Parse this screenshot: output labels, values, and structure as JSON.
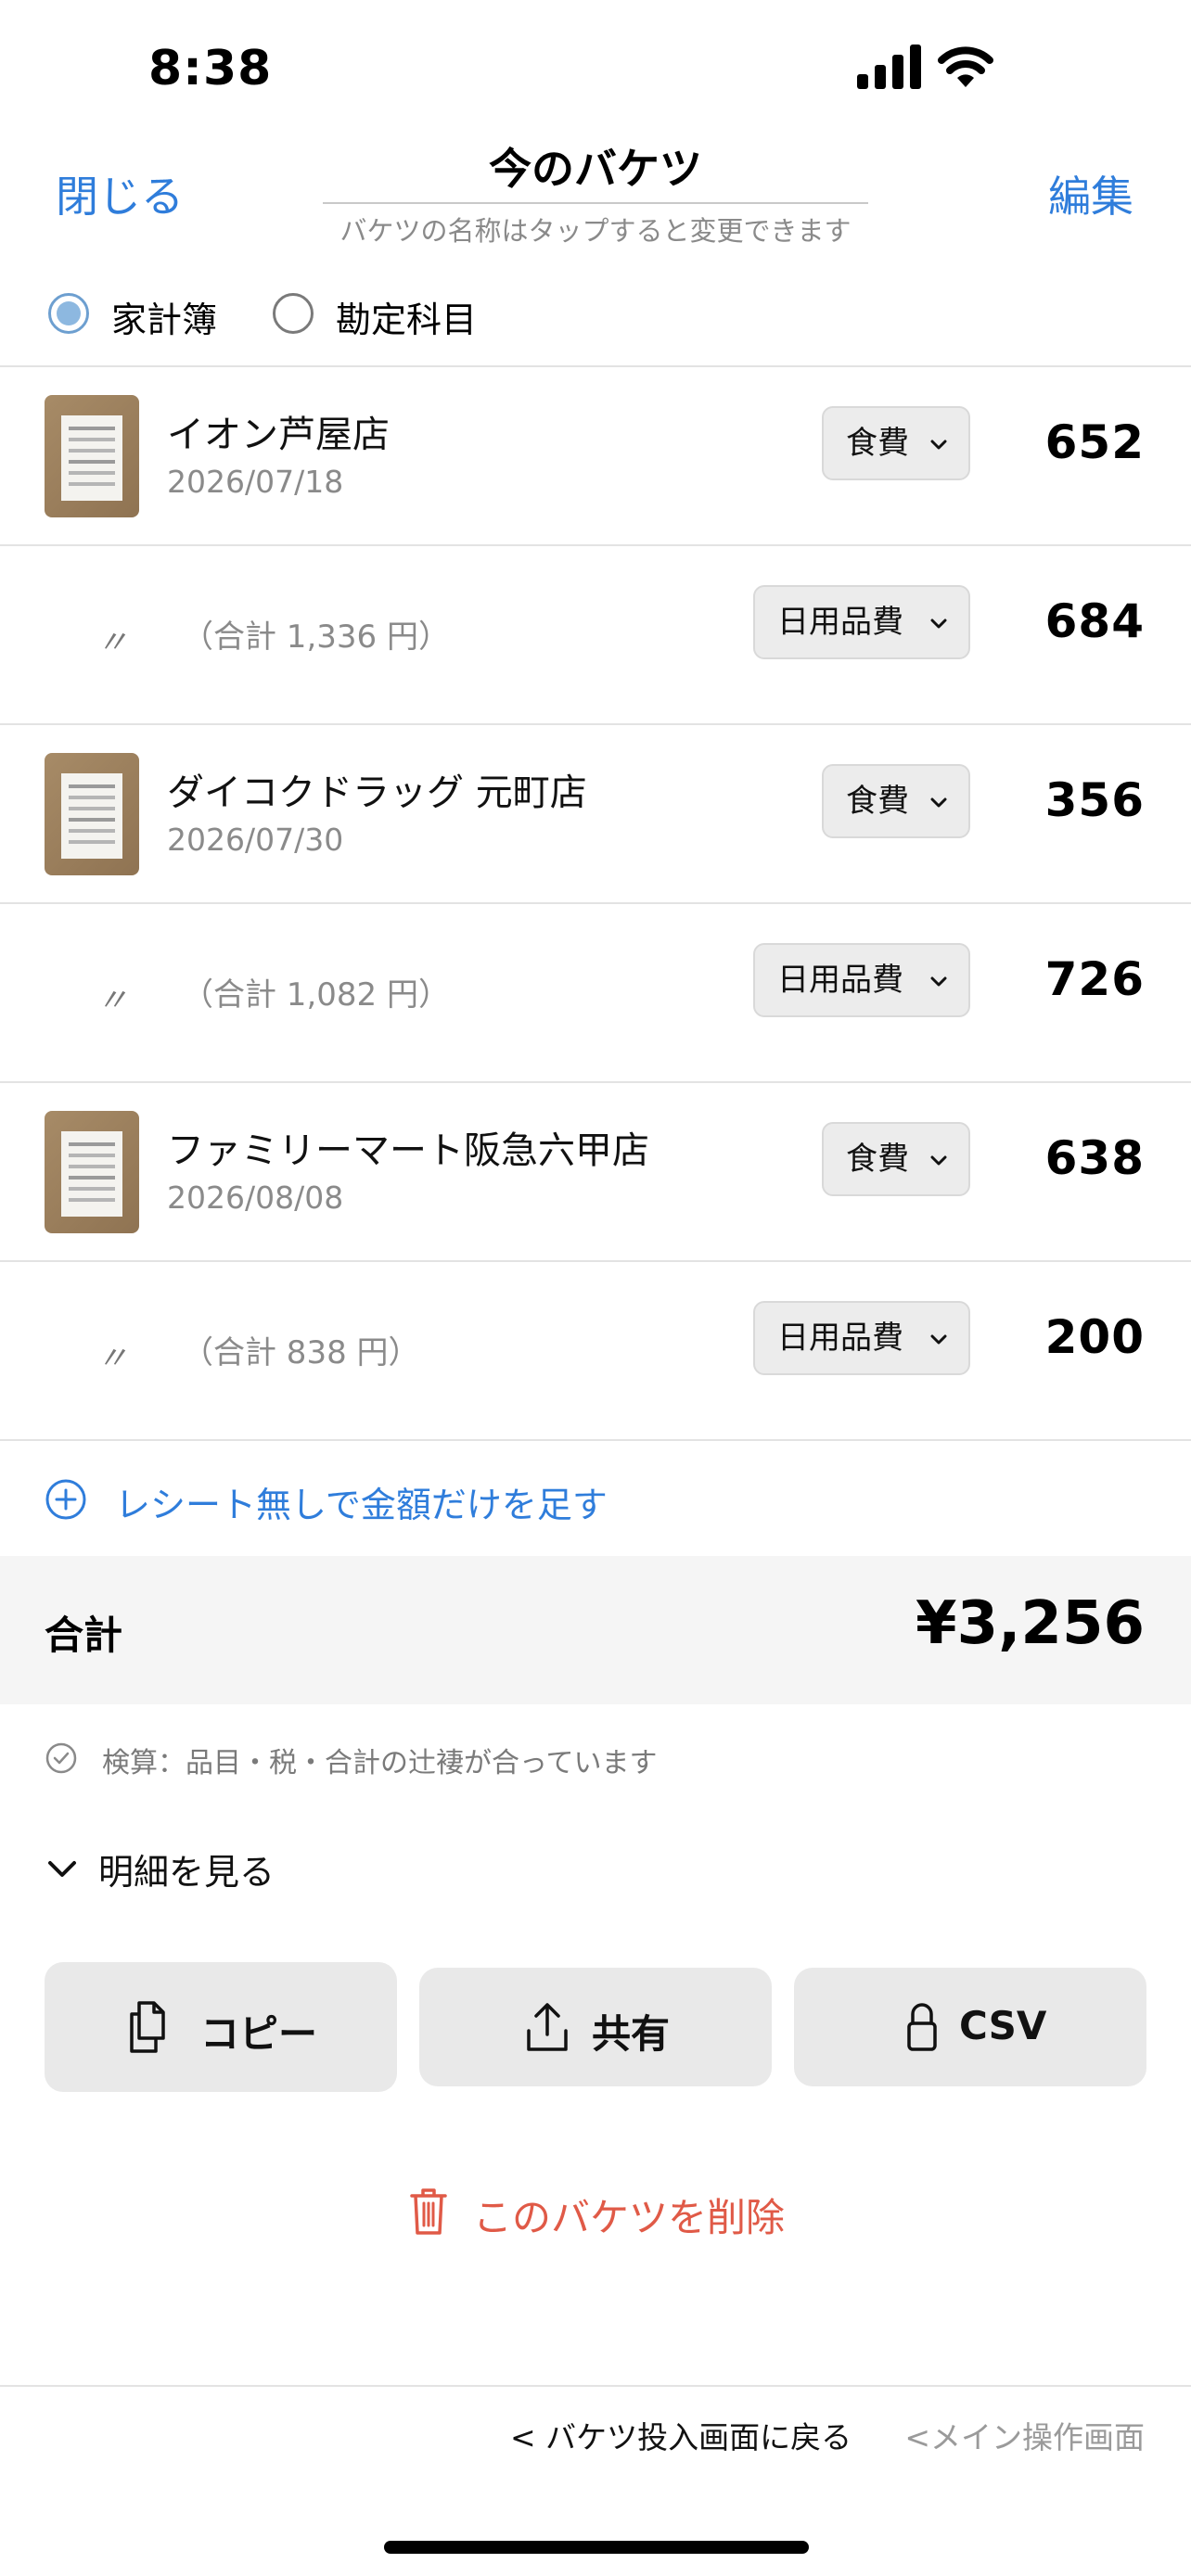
{
  "status": {
    "time": "8:38"
  },
  "nav": {
    "close": "閉じる",
    "title": "今のバケツ",
    "hint": "バケツの名称はタップすると変更できます",
    "edit": "編集"
  },
  "mode": {
    "options": [
      {
        "label": "家計簿",
        "selected": true
      },
      {
        "label": "勘定科目",
        "selected": false
      }
    ]
  },
  "rows": [
    {
      "kind": "receipt",
      "store": "イオン芦屋店",
      "date": "2026/07/18",
      "category": "食費",
      "amount": "652"
    },
    {
      "kind": "split",
      "ditto": "〃",
      "subtotal": "（合計 1,336 円）",
      "category": "日用品費",
      "amount": "684"
    },
    {
      "kind": "receipt",
      "store": "ダイコクドラッグ 元町店",
      "date": "2026/07/30",
      "category": "食費",
      "amount": "356"
    },
    {
      "kind": "split",
      "ditto": "〃",
      "subtotal": "（合計 1,082 円）",
      "category": "日用品費",
      "amount": "726"
    },
    {
      "kind": "receipt",
      "store": "ファミリーマート阪急六甲店",
      "date": "2026/08/08",
      "category": "食費",
      "amount": "638"
    },
    {
      "kind": "split",
      "ditto": "〃",
      "subtotal": "（合計 838 円）",
      "category": "日用品費",
      "amount": "200"
    }
  ],
  "add_amount": {
    "label": "レシート無しで金額だけを足す"
  },
  "total": {
    "label": "合計",
    "value": "¥3,256"
  },
  "verification": {
    "text": "検算：品目・税・合計の辻褄が合っています"
  },
  "details": {
    "label": "明細を見る"
  },
  "actions": {
    "copy": "コピー",
    "share": "共有",
    "csv": "CSV"
  },
  "delete": {
    "label": "このバケツを削除"
  },
  "footer": {
    "back_bucket": "< バケツ投入画面に戻る",
    "back_main": "<メイン操作画面"
  },
  "colors": {
    "accent": "#2f7ddb",
    "danger": "#e05a47",
    "muted": "#8a8a8a"
  },
  "icons": [
    "signal-icon",
    "wifi-icon",
    "plus-circle-icon",
    "check-circle-icon",
    "chevron-down-icon",
    "copy-icon",
    "share-icon",
    "lock-icon",
    "trash-icon"
  ]
}
